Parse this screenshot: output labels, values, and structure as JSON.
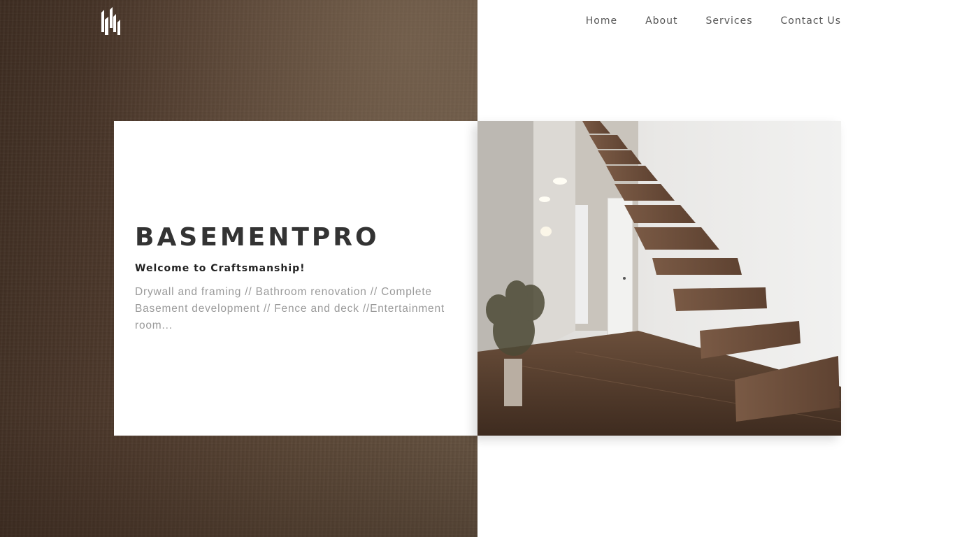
{
  "header": {
    "logo_icon": "bars-logo-icon",
    "nav": [
      {
        "label": "Home"
      },
      {
        "label": "About"
      },
      {
        "label": "Services"
      },
      {
        "label": "Contact Us"
      }
    ]
  },
  "hero": {
    "title": "BASEMENTPRO",
    "subtitle": "Welcome to Craftsmanship!",
    "services_text": "Drywall and framing // Bathroom renovation // Complete Basement development // Fence and deck //Entertainment room..."
  },
  "colors": {
    "wood_dark": "#3e2d22",
    "wood_light": "#6a5745",
    "title": "#333333",
    "body_text": "#9a9a9a",
    "nav_text": "#555555"
  }
}
